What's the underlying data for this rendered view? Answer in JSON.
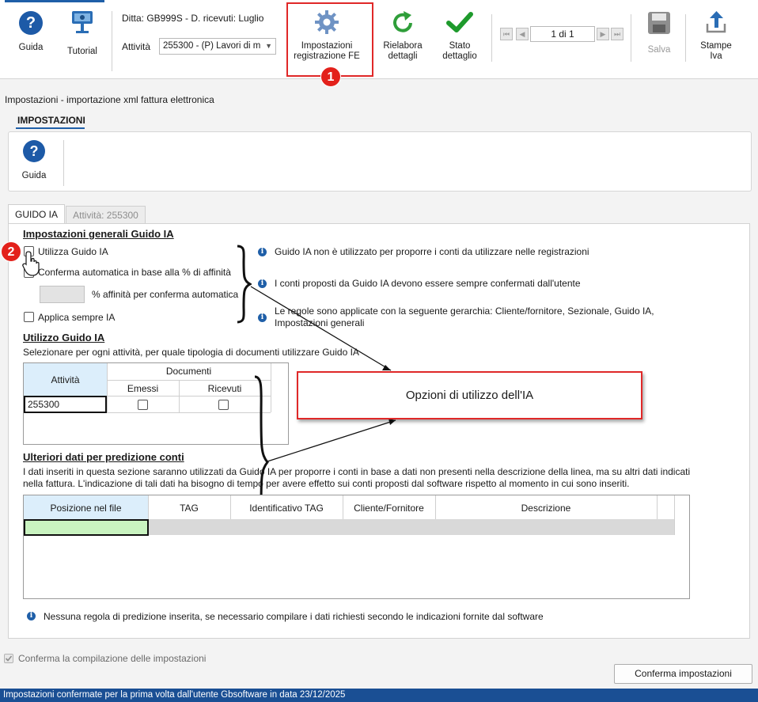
{
  "toolbar": {
    "guida": "Guida",
    "tutorial": "Tutorial",
    "ditta": "Ditta: GB999S - D. ricevuti: Luglio",
    "attivita_label": "Attività",
    "attivita_value": "255300 - (P) Lavori di m",
    "impostazioni_fe_line1": "Impostazioni",
    "impostazioni_fe_line2": "registrazione FE",
    "rielabora_line1": "Rielabora",
    "rielabora_line2": "dettagli",
    "stato_line1": "Stato",
    "stato_line2": "dettaglio",
    "pager": "1 di 1",
    "salva": "Salva",
    "stampe_line1": "Stampe",
    "stampe_line2": "Iva"
  },
  "badges": {
    "one": "1",
    "two": "2"
  },
  "panel": {
    "title": "Impostazioni - importazione xml fattura elettronica",
    "tab": "IMPOSTAZIONI",
    "guida": "Guida"
  },
  "tabs": {
    "guido_ia": "GUIDO IA",
    "attivita": "Attività: 255300"
  },
  "general": {
    "title": "Impostazioni generali Guido IA",
    "utilizza": "Utilizza Guido IA",
    "conferma": "Conferma automatica in base alla % di affinità",
    "perc": "% affinità per conferma automatica",
    "applica": "Applica sempre IA",
    "info1": "Guido IA non è utilizzato per proporre i conti da utilizzare nelle registrazioni",
    "info2": "I conti proposti da Guido IA devono essere sempre confermati dall'utente",
    "info3_line1": "Le regole sono applicate con la seguente gerarchia: Cliente/fornitore, Sezionale, Guido IA,",
    "info3_line2": "Impostazioni generali"
  },
  "utilizzo": {
    "title": "Utilizzo Guido IA",
    "subtitle": "Selezionare per ogni attività, per quale tipologia di documenti utilizzare Guido IA",
    "col_attivita": "Attività",
    "col_documenti": "Documenti",
    "col_emessi": "Emessi",
    "col_ricevuti": "Ricevuti",
    "row_attivita": "255300"
  },
  "annotation": "Opzioni di utilizzo dell'IA",
  "ulteriori": {
    "title": "Ulteriori dati per predizione conti",
    "desc_line1": "I dati inseriti in questa sezione saranno utilizzati da Guido IA per proporre i conti in base a dati non presenti nella descrizione della linea, ma su altri dati indicati",
    "desc_line2": "nella fattura. L'indicazione di tali dati ha bisogno di tempo per avere effetto sui conti proposti dal software rispetto al momento in cui sono inseriti.",
    "columns": [
      "Posizione nel file",
      "TAG",
      "Identificativo TAG",
      "Cliente/Fornitore",
      "Descrizione"
    ],
    "note": "Nessuna regola di predizione inserita, se necessario compilare i dati richiesti secondo le indicazioni fornite dal software"
  },
  "footer": {
    "conferma_compilazione": "Conferma la compilazione delle impostazioni",
    "conferma_button": "Conferma impostazioni",
    "status": "Impostazioni confermate per la prima volta dall'utente Gbsoftware in data 23/12/2025"
  },
  "colors": {
    "accent": "#1f5fa8",
    "annotation_red": "#e02828",
    "status_blue": "#1a4f94",
    "grid_green": "#c9f3c0"
  }
}
